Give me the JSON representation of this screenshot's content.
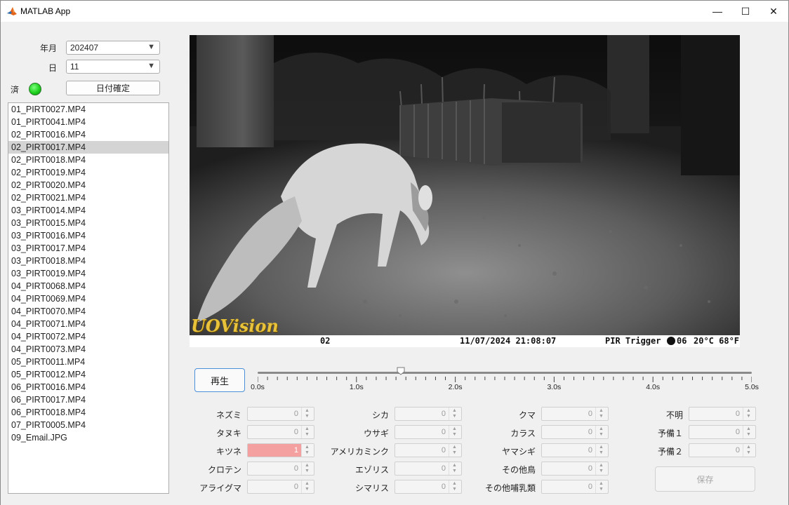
{
  "window": {
    "title": "MATLAB App",
    "minimize_glyph": "—",
    "maximize_glyph": "☐",
    "close_glyph": "✕"
  },
  "date": {
    "year_month_label": "年月",
    "year_month_value": "202407",
    "day_label": "日",
    "day_value": "11",
    "done_label": "済",
    "confirm_button": "日付確定",
    "lamp_color": "#1fd11f"
  },
  "files": {
    "selected": "02_PIRT0017.MP4",
    "items": [
      "01_PIRT0027.MP4",
      "01_PIRT0041.MP4",
      "02_PIRT0016.MP4",
      "02_PIRT0017.MP4",
      "02_PIRT0018.MP4",
      "02_PIRT0019.MP4",
      "02_PIRT0020.MP4",
      "02_PIRT0021.MP4",
      "03_PIRT0014.MP4",
      "03_PIRT0015.MP4",
      "03_PIRT0016.MP4",
      "03_PIRT0017.MP4",
      "03_PIRT0018.MP4",
      "03_PIRT0019.MP4",
      "04_PIRT0068.MP4",
      "04_PIRT0069.MP4",
      "04_PIRT0070.MP4",
      "04_PIRT0071.MP4",
      "04_PIRT0072.MP4",
      "04_PIRT0073.MP4",
      "05_PIRT0011.MP4",
      "05_PIRT0012.MP4",
      "06_PIRT0016.MP4",
      "06_PIRT0017.MP4",
      "06_PIRT0018.MP4",
      "07_PIRT0005.MP4",
      "09_Email.JPG"
    ]
  },
  "video": {
    "logo_text": "UOVision",
    "camera_id": "02",
    "timestamp": "11/07/2024 21:08:07",
    "trigger": "PIR Trigger",
    "moon_phase": "06",
    "temperature": "20°C 68°F"
  },
  "playback": {
    "play_button": "再生",
    "position_seconds": 1.45,
    "tick_labels": [
      "0.0s",
      "1.0s",
      "2.0s",
      "3.0s",
      "4.0s",
      "5.0s"
    ]
  },
  "counters": {
    "columns": [
      [
        {
          "label": "ネズミ",
          "value": "0"
        },
        {
          "label": "タヌキ",
          "value": "0"
        },
        {
          "label": "キツネ",
          "value": "1",
          "highlight": true
        },
        {
          "label": "クロテン",
          "value": "0"
        },
        {
          "label": "アライグマ",
          "value": "0"
        }
      ],
      [
        {
          "label": "シカ",
          "value": "0"
        },
        {
          "label": "ウサギ",
          "value": "0"
        },
        {
          "label": "アメリカミンク",
          "value": "0"
        },
        {
          "label": "エゾリス",
          "value": "0"
        },
        {
          "label": "シマリス",
          "value": "0"
        }
      ],
      [
        {
          "label": "クマ",
          "value": "0"
        },
        {
          "label": "カラス",
          "value": "0"
        },
        {
          "label": "ヤマシギ",
          "value": "0"
        },
        {
          "label": "その他鳥",
          "value": "0"
        },
        {
          "label": "その他哺乳類",
          "value": "0"
        }
      ],
      [
        {
          "label": "不明",
          "value": "0"
        },
        {
          "label": "予備１",
          "value": "0"
        },
        {
          "label": "予備２",
          "value": "0"
        }
      ]
    ],
    "highlight_color": "#f4a0a0",
    "save_button": "保存"
  }
}
